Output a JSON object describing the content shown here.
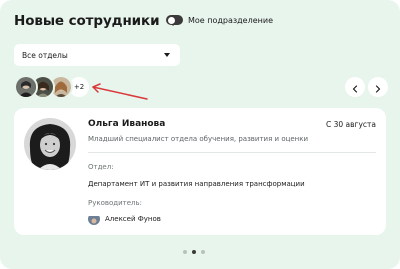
{
  "header": {
    "title": "Новые сотрудники",
    "toggle_label": "Мое подразделение",
    "toggle_on": false
  },
  "filter": {
    "selected": "Все отделы"
  },
  "avatars": {
    "more_label": "+2"
  },
  "employee": {
    "name": "Ольга Иванова",
    "date": "С 30 августа",
    "role": "Младший специалист отдела обучения, развития и оценки",
    "department_label": "Отдел:",
    "department": "Департамент ИТ и развития направления трансформации",
    "manager_label": "Руководитель:",
    "manager": "Алексей Фунов"
  },
  "pagination": {
    "pages": 3,
    "active": 2
  },
  "colors": {
    "panel_bg": "#e8f5ec",
    "annotation_arrow": "#d9393b",
    "toggle_off": "#3a3a3a"
  },
  "icons": {
    "title_chevron": "chevron-right-icon",
    "select_caret": "caret-down-icon",
    "prev": "chevron-left-icon",
    "next": "chevron-right-icon"
  }
}
